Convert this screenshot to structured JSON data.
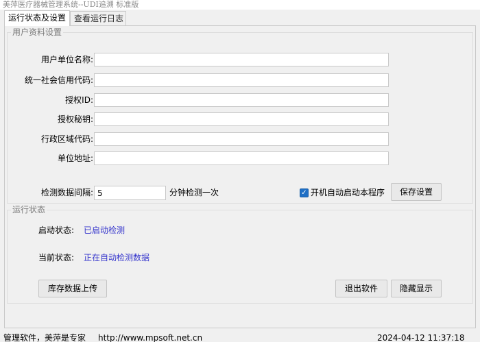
{
  "window": {
    "title": "美萍医疗器械管理系统--UDI追溯 标准版"
  },
  "tabs": [
    {
      "label": "运行状态及设置"
    },
    {
      "label": "查看运行日志"
    }
  ],
  "profile": {
    "group_title": "用户资料设置",
    "fields": [
      {
        "label": "用户单位名称:",
        "value": ""
      },
      {
        "label": "统一社会信用代码:",
        "value": ""
      },
      {
        "label": "授权ID:",
        "value": ""
      },
      {
        "label": "授权秘钥:",
        "value": ""
      },
      {
        "label": "行政区域代码:",
        "value": ""
      },
      {
        "label": "单位地址:",
        "value": ""
      }
    ],
    "interval_label": "检测数据间隔:",
    "interval_value": "5",
    "interval_unit": "分钟检测一次",
    "autostart_label": "开机自动启动本程序",
    "autostart_checked": true,
    "save_button": "保存设置"
  },
  "runtime": {
    "group_title": "运行状态",
    "start_state_label": "启动状态:",
    "start_state_value": "已启动检测",
    "current_state_label": "当前状态:",
    "current_state_value": "正在自动检测数据",
    "upload_button": "库存数据上传",
    "exit_button": "退出软件",
    "hide_button": "隐藏显示"
  },
  "statusbar": {
    "left": "管理软件，美萍是专家",
    "url": "http://www.mpsoft.net.cn",
    "datetime": "2024-04-12 11:37:18"
  },
  "colors": {
    "status_text": "#3333cc",
    "checkbox": "#1f6fc5"
  }
}
